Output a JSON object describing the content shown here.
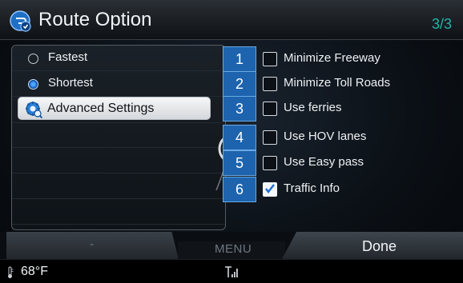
{
  "header": {
    "title": "Route Option",
    "page": "3/3",
    "icon": "route-settings-icon"
  },
  "left_menu": {
    "items": [
      {
        "label": "Fastest",
        "type": "radio",
        "selected": false
      },
      {
        "label": "Shortest",
        "type": "radio",
        "selected": true
      },
      {
        "label": "Advanced Settings",
        "type": "button",
        "icon": "gear-search-icon"
      }
    ]
  },
  "options": [
    {
      "number": "1",
      "label": "Minimize Freeway",
      "checked": false
    },
    {
      "number": "2",
      "label": "Minimize Toll Roads",
      "checked": false
    },
    {
      "number": "3",
      "label": "Use ferries",
      "checked": false
    },
    {
      "number": "4",
      "label": "Use HOV lanes",
      "checked": false
    },
    {
      "number": "5",
      "label": "Use Easy pass",
      "checked": false
    },
    {
      "number": "6",
      "label": "Traffic Info",
      "checked": true
    }
  ],
  "bottom_tabs": {
    "left": "-",
    "center": "MENU",
    "right": "Done"
  },
  "status_bar": {
    "temperature": "68°F",
    "signal_icon": "signal-icon"
  },
  "colors": {
    "accent": "#1fb5a8",
    "number_badge": "#1d63ad",
    "radio_selected": "#1e6fd0"
  }
}
